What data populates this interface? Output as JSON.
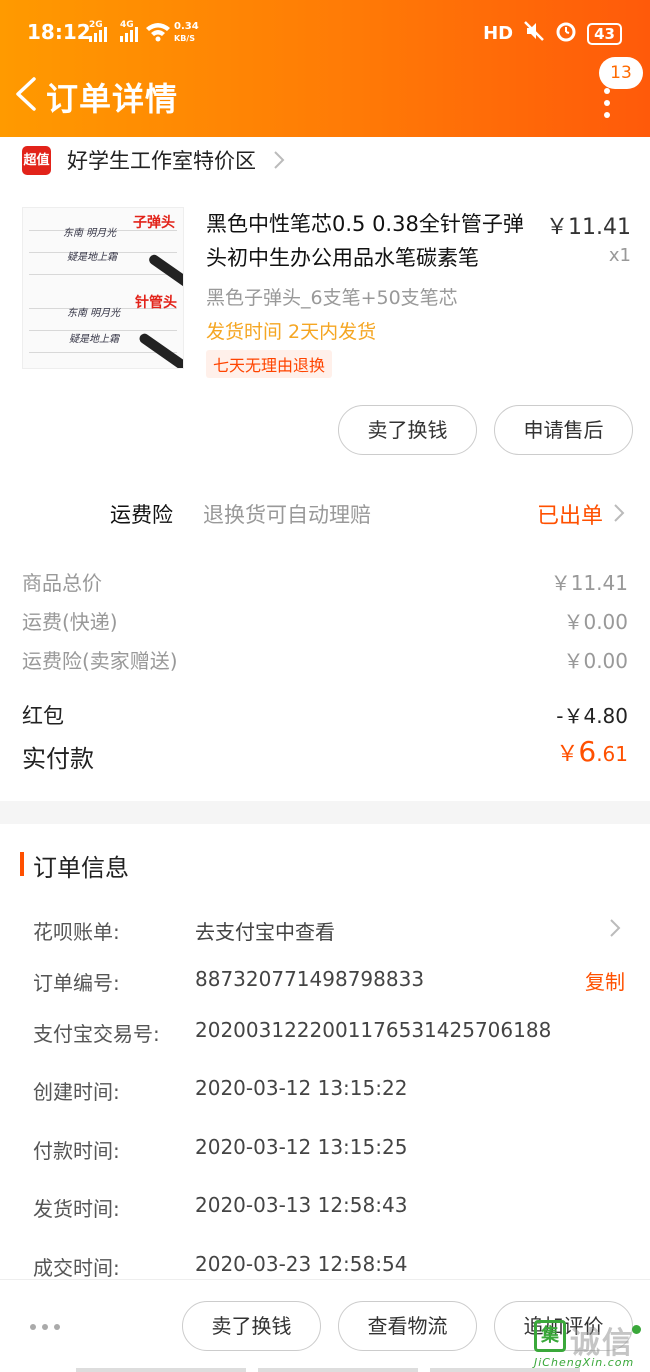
{
  "status_bar": {
    "time": "18:12",
    "net1": "2G",
    "net2": "4G",
    "speed": "0.34",
    "speed_unit": "KB/S",
    "hd": "HD",
    "battery": "43"
  },
  "header": {
    "title": "订单详情",
    "notification_count": "13"
  },
  "shop": {
    "logo_text": "超值",
    "name": "好学生工作室特价区"
  },
  "product": {
    "title": "黑色中性笔芯0.5 0.38全针管子弹头初中生办公用品水笔碳素笔",
    "price": "￥11.41",
    "quantity": "x1",
    "spec": "黑色子弹头_6支笔+50支笔芯",
    "ship_time": "发货时间 2天内发货",
    "return_tag": "七天无理由退换",
    "thumb_tag_1": "子弹头",
    "thumb_tag_2": "针管头"
  },
  "product_actions": {
    "sell": "卖了换钱",
    "after_sale": "申请售后"
  },
  "insurance": {
    "label": "运费险",
    "desc": "退换货可自动理赔",
    "status": "已出单"
  },
  "fees": [
    {
      "label": "商品总价",
      "value": "￥11.41"
    },
    {
      "label": "运费(快递)",
      "value": "￥0.00"
    },
    {
      "label": "运费险(卖家赠送)",
      "value": "￥0.00"
    }
  ],
  "red_packet": {
    "label": "红包",
    "value": "-￥4.80"
  },
  "paid": {
    "label": "实付款",
    "currency": "￥",
    "integer": "6",
    "decimal": ".61"
  },
  "order_info": {
    "section_title": "订单信息",
    "rows": [
      {
        "label": "花呗账单:",
        "value": "去支付宝中查看"
      },
      {
        "label": "订单编号:",
        "value": "887320771498798833"
      },
      {
        "label": "支付宝交易号:",
        "value": "2020031222001176531425706188"
      },
      {
        "label": "创建时间:",
        "value": "2020-03-12 13:15:22"
      },
      {
        "label": "付款时间:",
        "value": "2020-03-12 13:15:25"
      },
      {
        "label": "发货时间:",
        "value": "2020-03-13 12:58:43"
      },
      {
        "label": "成交时间:",
        "value": "2020-03-23 12:58:54"
      }
    ],
    "copy": "复制"
  },
  "bottom_actions": {
    "sell": "卖了换钱",
    "logistics": "查看物流",
    "review": "追加评价"
  },
  "watermark": {
    "text": "诚信",
    "logo": "集",
    "url": "JiChengXin.com"
  },
  "colors": {
    "header_start": "#ff9a00",
    "header_end": "#ff5a0a",
    "accent": "#ff5000",
    "ship_time": "#f5a623"
  }
}
